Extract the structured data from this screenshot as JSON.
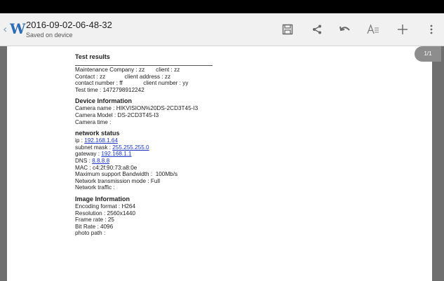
{
  "header": {
    "title": "2016-09-02-06-48-32",
    "subtitle": "Saved on device"
  },
  "toolbar": {
    "icons": [
      "save-icon",
      "share-icon",
      "undo-icon",
      "text-format-icon",
      "add-icon",
      "more-icon"
    ]
  },
  "page_indicator": "1/1",
  "document": {
    "title": "Test results",
    "maintenance": {
      "company_label": "Maintenance Company",
      "company": "zz",
      "client_label": "client",
      "client": "zz"
    },
    "contact": {
      "contact_label": "Contact",
      "contact": "zz",
      "client_address_label": "client address",
      "client_address": "zz"
    },
    "contact_number": {
      "label": "contact number",
      "value": "ff",
      "client_number_label": "client number",
      "client_number": "yy"
    },
    "test_time": {
      "label": "Test time",
      "value": "1472798912242"
    },
    "device_info": {
      "heading": "Device Information",
      "camera_name_label": "Camera name",
      "camera_name": "HIKVISION%20DS-2CD3T45-I3",
      "camera_model_label": "Camera Model",
      "camera_model": "DS-2CD3T45-I3",
      "camera_time_label": "Camera time",
      "camera_time": ""
    },
    "network": {
      "heading": "network status",
      "ip_label": "ip",
      "ip": "192.168.1.64",
      "subnet_label": "subnet mask",
      "subnet": "255.255.255.0",
      "gateway_label": "gateway",
      "gateway": "192.168.1.1",
      "dns_label": "DNS",
      "dns": "8.8.8.8",
      "mac_label": "MAC",
      "mac": "c4:2f:90:73:a8:0e",
      "bandwidth_label": "Maximum support Bandwidth",
      "bandwidth": "100Mb/s",
      "mode_label": "Network transmission mode",
      "mode": "Full",
      "traffic_label": "Network traffic",
      "traffic": ""
    },
    "image": {
      "heading": "Image Information",
      "encoding_label": "Encoding format",
      "encoding": "H264",
      "resolution_label": "Resolution",
      "resolution": "2560x1440",
      "framerate_label": "Frame rate",
      "framerate": "25",
      "bitrate_label": "Bit Rate",
      "bitrate": "4096",
      "photo_label": "photo path",
      "photo": ""
    }
  },
  "colors": {
    "link": "#1a35c8",
    "accent": "#2b6cb5"
  }
}
